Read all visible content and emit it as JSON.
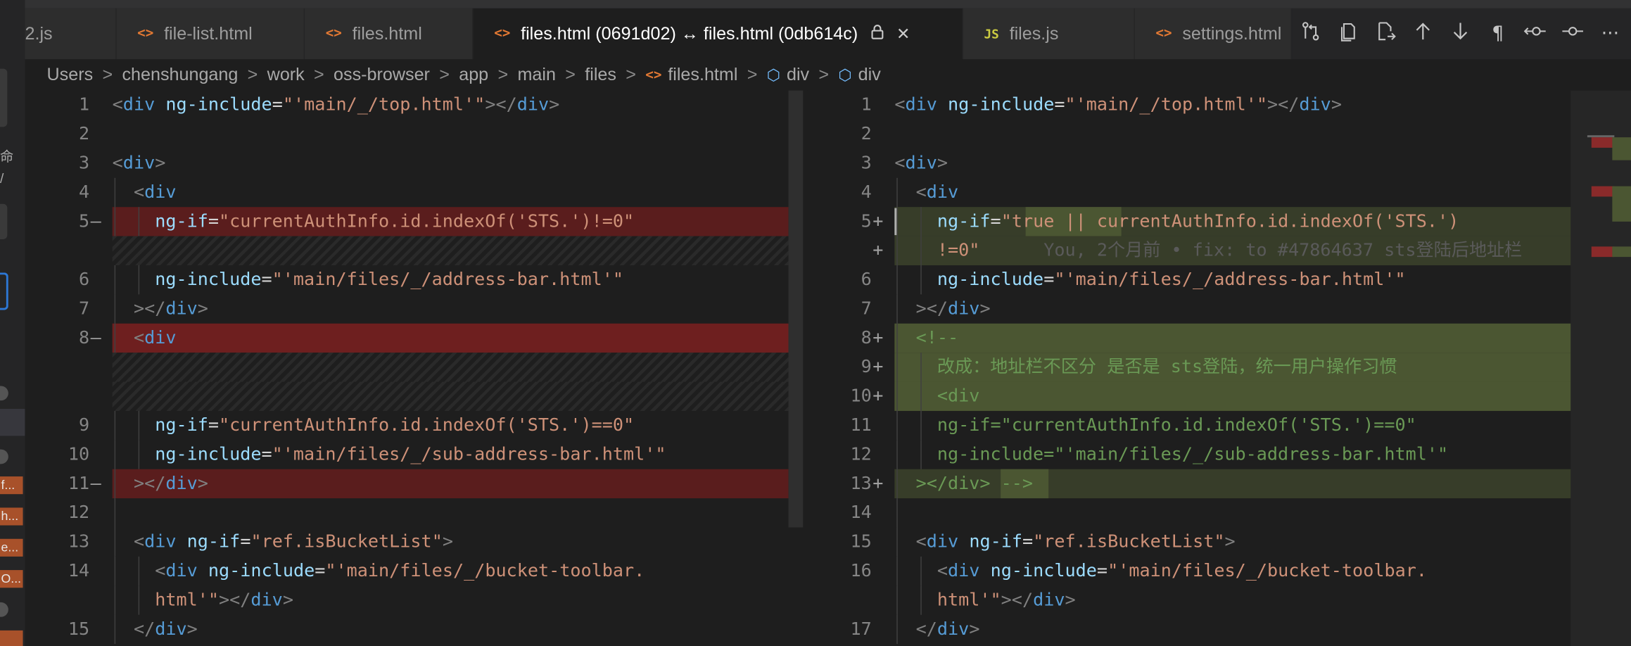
{
  "tabs": [
    {
      "icon": "",
      "label": "2.js"
    },
    {
      "icon": "<>",
      "label": "file-list.html"
    },
    {
      "icon": "<>",
      "label": "files.html"
    },
    {
      "icon": "<>",
      "label": "files.html (0691d02) ↔ files.html (0db614c)"
    },
    {
      "icon": "JS",
      "label": "files.js"
    },
    {
      "icon": "<>",
      "label": "settings.html"
    }
  ],
  "activity_tags": [
    "f...",
    "h...",
    "e...",
    "O..."
  ],
  "activity_side_glyphs": [
    "命",
    "/"
  ],
  "breadcrumb": {
    "items": [
      "Users",
      "chenshungang",
      "work",
      "oss-browser",
      "app",
      "main",
      "files",
      "files.html",
      "div",
      "div"
    ],
    "sep": ">"
  },
  "toolbar_icons": [
    "open-changes-icon",
    "copy-file-icon",
    "open-file-icon",
    "arrow-up-icon",
    "arrow-down-icon",
    "pilcrow-icon",
    "inline-diff-icon",
    "compare-icon",
    "more-icon"
  ],
  "left": {
    "lines": [
      {
        "n": "1",
        "m": "",
        "kind": "",
        "guides": 0,
        "tokens": [
          [
            "t-br",
            "<"
          ],
          [
            "t-tag",
            "div"
          ],
          [
            "t-txt",
            " "
          ],
          [
            "t-attr",
            "ng-include"
          ],
          [
            "t-txt",
            "="
          ],
          [
            "t-str",
            "\"'main/_/top.html'\""
          ],
          [
            "t-br",
            "></"
          ],
          [
            "t-tag",
            "div"
          ],
          [
            "t-br",
            ">"
          ]
        ]
      },
      {
        "n": "2",
        "m": "",
        "kind": "",
        "guides": 0,
        "tokens": []
      },
      {
        "n": "3",
        "m": "",
        "kind": "",
        "guides": 0,
        "tokens": [
          [
            "t-br",
            "<"
          ],
          [
            "t-tag",
            "div"
          ],
          [
            "t-br",
            ">"
          ]
        ]
      },
      {
        "n": "4",
        "m": "",
        "kind": "",
        "guides": 1,
        "tokens": [
          [
            "t-txt",
            "  "
          ],
          [
            "t-br",
            "<"
          ],
          [
            "t-tag",
            "div"
          ]
        ]
      },
      {
        "n": "5",
        "m": "—",
        "kind": "del",
        "guides": 2,
        "tokens": [
          [
            "t-txt",
            "    "
          ],
          [
            "t-attr",
            "ng-if"
          ],
          [
            "t-txt",
            "="
          ],
          [
            "t-str",
            "\"currentAuthInfo.id.indexOf('STS.')!=0\""
          ]
        ]
      },
      {
        "n": "",
        "m": "",
        "kind": "hatch",
        "guides": 0,
        "tokens": []
      },
      {
        "n": "6",
        "m": "",
        "kind": "",
        "guides": 2,
        "tokens": [
          [
            "t-txt",
            "    "
          ],
          [
            "t-attr",
            "ng-include"
          ],
          [
            "t-txt",
            "="
          ],
          [
            "t-str",
            "\"'main/files/_/address-bar.html'\""
          ]
        ]
      },
      {
        "n": "7",
        "m": "",
        "kind": "",
        "guides": 1,
        "tokens": [
          [
            "t-txt",
            "  "
          ],
          [
            "t-br",
            "></"
          ],
          [
            "t-tag",
            "div"
          ],
          [
            "t-br",
            ">"
          ]
        ]
      },
      {
        "n": "8",
        "m": "—",
        "kind": "del-strong",
        "guides": 1,
        "tokens": [
          [
            "t-txt",
            "  "
          ],
          [
            "t-br",
            "<"
          ],
          [
            "t-tag",
            "div"
          ]
        ]
      },
      {
        "n": "",
        "m": "",
        "kind": "hatch",
        "guides": 0,
        "tokens": []
      },
      {
        "n": "",
        "m": "",
        "kind": "hatch",
        "guides": 0,
        "tokens": []
      },
      {
        "n": "9",
        "m": "",
        "kind": "",
        "guides": 2,
        "tokens": [
          [
            "t-txt",
            "    "
          ],
          [
            "t-attr",
            "ng-if"
          ],
          [
            "t-txt",
            "="
          ],
          [
            "t-str",
            "\"currentAuthInfo.id.indexOf('STS.')==0\""
          ]
        ]
      },
      {
        "n": "10",
        "m": "",
        "kind": "",
        "guides": 2,
        "tokens": [
          [
            "t-txt",
            "    "
          ],
          [
            "t-attr",
            "ng-include"
          ],
          [
            "t-txt",
            "="
          ],
          [
            "t-str",
            "\"'main/files/_/sub-address-bar.html'\""
          ]
        ]
      },
      {
        "n": "11",
        "m": "—",
        "kind": "del",
        "guides": 1,
        "tokens": [
          [
            "t-txt",
            "  "
          ],
          [
            "t-br",
            "></"
          ],
          [
            "t-tag",
            "div"
          ],
          [
            "t-br",
            ">"
          ]
        ]
      },
      {
        "n": "12",
        "m": "",
        "kind": "",
        "guides": 1,
        "tokens": []
      },
      {
        "n": "13",
        "m": "",
        "kind": "",
        "guides": 1,
        "tokens": [
          [
            "t-txt",
            "  "
          ],
          [
            "t-br",
            "<"
          ],
          [
            "t-tag",
            "div"
          ],
          [
            "t-txt",
            " "
          ],
          [
            "t-attr",
            "ng-if"
          ],
          [
            "t-txt",
            "="
          ],
          [
            "t-str",
            "\"ref.isBucketList\""
          ],
          [
            "t-br",
            ">"
          ]
        ]
      },
      {
        "n": "14",
        "m": "",
        "kind": "",
        "guides": 2,
        "tokens": [
          [
            "t-txt",
            "    "
          ],
          [
            "t-br",
            "<"
          ],
          [
            "t-tag",
            "div"
          ],
          [
            "t-txt",
            " "
          ],
          [
            "t-attr",
            "ng-include"
          ],
          [
            "t-txt",
            "="
          ],
          [
            "t-str",
            "\"'main/files/_/bucket-toolbar."
          ]
        ]
      },
      {
        "n": "",
        "m": "",
        "kind": "",
        "guides": 2,
        "tokens": [
          [
            "t-txt",
            "    "
          ],
          [
            "t-str",
            "html'\""
          ],
          [
            "t-br",
            "></"
          ],
          [
            "t-tag",
            "div"
          ],
          [
            "t-br",
            ">"
          ]
        ]
      },
      {
        "n": "15",
        "m": "",
        "kind": "",
        "guides": 1,
        "tokens": [
          [
            "t-txt",
            "  "
          ],
          [
            "t-br",
            "</"
          ],
          [
            "t-tag",
            "div"
          ],
          [
            "t-br",
            ">"
          ]
        ]
      }
    ]
  },
  "right": {
    "lines": [
      {
        "n": "1",
        "m": "",
        "kind": "",
        "guides": 0,
        "tokens": [
          [
            "t-br",
            "<"
          ],
          [
            "t-tag",
            "div"
          ],
          [
            "t-txt",
            " "
          ],
          [
            "t-attr",
            "ng-include"
          ],
          [
            "t-txt",
            "="
          ],
          [
            "t-str",
            "\"'main/_/top.html'\""
          ],
          [
            "t-br",
            "></"
          ],
          [
            "t-tag",
            "div"
          ],
          [
            "t-br",
            ">"
          ]
        ]
      },
      {
        "n": "2",
        "m": "",
        "kind": "",
        "guides": 0,
        "tokens": []
      },
      {
        "n": "3",
        "m": "",
        "kind": "",
        "guides": 0,
        "tokens": [
          [
            "t-br",
            "<"
          ],
          [
            "t-tag",
            "div"
          ],
          [
            "t-br",
            ">"
          ]
        ]
      },
      {
        "n": "4",
        "m": "",
        "kind": "",
        "guides": 1,
        "tokens": [
          [
            "t-txt",
            "  "
          ],
          [
            "t-br",
            "<"
          ],
          [
            "t-tag",
            "div"
          ]
        ]
      },
      {
        "n": "5",
        "m": "+",
        "kind": "ins",
        "guides": 2,
        "hl": [
          126,
          92
        ],
        "tokens": [
          [
            "t-txt",
            "    "
          ],
          [
            "t-attr",
            "ng-if"
          ],
          [
            "t-txt",
            "="
          ],
          [
            "t-str",
            "\"true || currentAuthInfo.id.indexOf('STS.')"
          ]
        ]
      },
      {
        "n": "",
        "m": "+",
        "kind": "ins",
        "guides": 2,
        "tokens": [
          [
            "t-txt",
            "    "
          ],
          [
            "t-str",
            "!=0\""
          ],
          [
            "t-blame",
            "      You, 2个月前 • fix: to #47864637 sts登陆后地址栏"
          ]
        ]
      },
      {
        "n": "6",
        "m": "",
        "kind": "",
        "guides": 2,
        "tokens": [
          [
            "t-txt",
            "    "
          ],
          [
            "t-attr",
            "ng-include"
          ],
          [
            "t-txt",
            "="
          ],
          [
            "t-str",
            "\"'main/files/_/address-bar.html'\""
          ]
        ]
      },
      {
        "n": "7",
        "m": "",
        "kind": "",
        "guides": 1,
        "tokens": [
          [
            "t-txt",
            "  "
          ],
          [
            "t-br",
            "></"
          ],
          [
            "t-tag",
            "div"
          ],
          [
            "t-br",
            ">"
          ]
        ]
      },
      {
        "n": "8",
        "m": "+",
        "kind": "ins-strong",
        "guides": 1,
        "tokens": [
          [
            "t-txt",
            "  "
          ],
          [
            "t-com",
            "<!--"
          ]
        ]
      },
      {
        "n": "9",
        "m": "+",
        "kind": "ins-strong",
        "guides": 2,
        "tokens": [
          [
            "t-txt",
            "    "
          ],
          [
            "t-com",
            "改成：地址栏不区分 是否是 sts登陆，统一用户操作习惯"
          ]
        ]
      },
      {
        "n": "10",
        "m": "+",
        "kind": "ins-strong",
        "guides": 2,
        "tokens": [
          [
            "t-txt",
            "    "
          ],
          [
            "t-com",
            "<div"
          ]
        ]
      },
      {
        "n": "11",
        "m": "",
        "kind": "",
        "guides": 2,
        "tokens": [
          [
            "t-txt",
            "    "
          ],
          [
            "t-com",
            "ng-if=\"currentAuthInfo.id.indexOf('STS.')==0\""
          ]
        ]
      },
      {
        "n": "12",
        "m": "",
        "kind": "",
        "guides": 2,
        "tokens": [
          [
            "t-txt",
            "    "
          ],
          [
            "t-com",
            "ng-include=\"'main/files/_/sub-address-bar.html'\""
          ]
        ]
      },
      {
        "n": "13",
        "m": "+",
        "kind": "ins",
        "guides": 1,
        "hl": [
          102,
          46
        ],
        "tokens": [
          [
            "t-txt",
            "  "
          ],
          [
            "t-com",
            "></div> -->"
          ]
        ]
      },
      {
        "n": "14",
        "m": "",
        "kind": "",
        "guides": 1,
        "tokens": []
      },
      {
        "n": "15",
        "m": "",
        "kind": "",
        "guides": 1,
        "tokens": [
          [
            "t-txt",
            "  "
          ],
          [
            "t-br",
            "<"
          ],
          [
            "t-tag",
            "div"
          ],
          [
            "t-txt",
            " "
          ],
          [
            "t-attr",
            "ng-if"
          ],
          [
            "t-txt",
            "="
          ],
          [
            "t-str",
            "\"ref.isBucketList\""
          ],
          [
            "t-br",
            ">"
          ]
        ]
      },
      {
        "n": "16",
        "m": "",
        "kind": "",
        "guides": 2,
        "tokens": [
          [
            "t-txt",
            "    "
          ],
          [
            "t-br",
            "<"
          ],
          [
            "t-tag",
            "div"
          ],
          [
            "t-txt",
            " "
          ],
          [
            "t-attr",
            "ng-include"
          ],
          [
            "t-txt",
            "="
          ],
          [
            "t-str",
            "\"'main/files/_/bucket-toolbar."
          ]
        ]
      },
      {
        "n": "",
        "m": "",
        "kind": "",
        "guides": 2,
        "tokens": [
          [
            "t-txt",
            "    "
          ],
          [
            "t-str",
            "html'\""
          ],
          [
            "t-br",
            "></"
          ],
          [
            "t-tag",
            "div"
          ],
          [
            "t-br",
            ">"
          ]
        ]
      },
      {
        "n": "17",
        "m": "",
        "kind": "",
        "guides": 1,
        "tokens": [
          [
            "t-txt",
            "  "
          ],
          [
            "t-br",
            "</"
          ],
          [
            "t-tag",
            "div"
          ],
          [
            "t-br",
            ">"
          ]
        ]
      }
    ]
  },
  "colors": {
    "accent": "#007acc",
    "deleted": "#6e1f1f",
    "inserted": "#4b5632"
  }
}
